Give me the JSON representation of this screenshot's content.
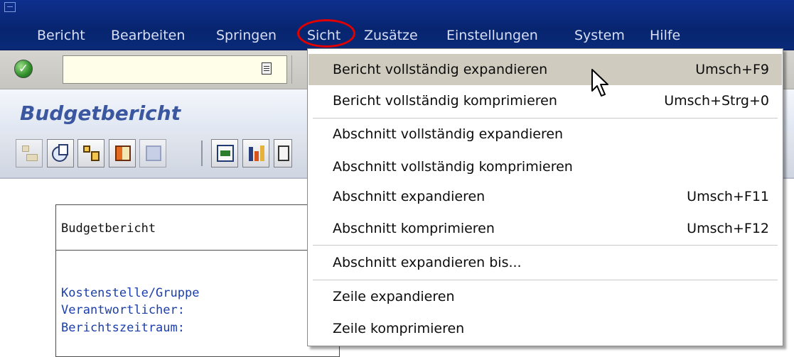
{
  "menubar": {
    "items": [
      {
        "label": "Bericht",
        "key": "e"
      },
      {
        "label": "Bearbeiten",
        "key": "B"
      },
      {
        "label": "Springen",
        "key": "S"
      },
      {
        "label": "Sicht",
        "key": "c"
      },
      {
        "label": "Zusätze",
        "key": "Z"
      },
      {
        "label": "Einstellungen",
        "key": "E"
      },
      {
        "label": "System",
        "key": "y"
      },
      {
        "label": "Hilfe",
        "key": "H"
      }
    ]
  },
  "toolbar": {
    "command_field_value": "",
    "enter_icon": "green-check-icon"
  },
  "title": {
    "text": "Budgetbericht"
  },
  "app_toolbar": {
    "buttons": [
      "hierarchy-icon",
      "object-icon",
      "structure-icon",
      "layout-icon",
      "info-icon",
      "export-icon",
      "chart-icon",
      "print-icon"
    ]
  },
  "report": {
    "title": "Budgetbericht",
    "fields": [
      "Kostenstelle/Gruppe",
      "Verantwortlicher:",
      "Berichtszeitraum:"
    ]
  },
  "dropdown": {
    "items": [
      {
        "label": "Bericht vollständig expandieren",
        "shortcut": "Umsch+F9",
        "hover": true
      },
      {
        "label": "Bericht vollständig komprimieren",
        "shortcut": "Umsch+Strg+0"
      },
      {
        "label": "Abschnitt vollständig expandieren",
        "shortcut": ""
      },
      {
        "label": "Abschnitt vollständig komprimieren",
        "shortcut": ""
      },
      {
        "label": "Abschnitt expandieren",
        "shortcut": "Umsch+F11"
      },
      {
        "label": "Abschnitt komprimieren",
        "shortcut": "Umsch+F12"
      },
      {
        "label": "Abschnitt expandieren bis...",
        "shortcut": ""
      },
      {
        "label": "Zeile expandieren",
        "shortcut": ""
      },
      {
        "label": "Zeile komprimieren",
        "shortcut": ""
      }
    ]
  },
  "colors": {
    "menubar": "#0a2a78",
    "highlight_circle": "#e00000",
    "title_text": "#3b57a0",
    "hover_row": "#cfccbf"
  }
}
